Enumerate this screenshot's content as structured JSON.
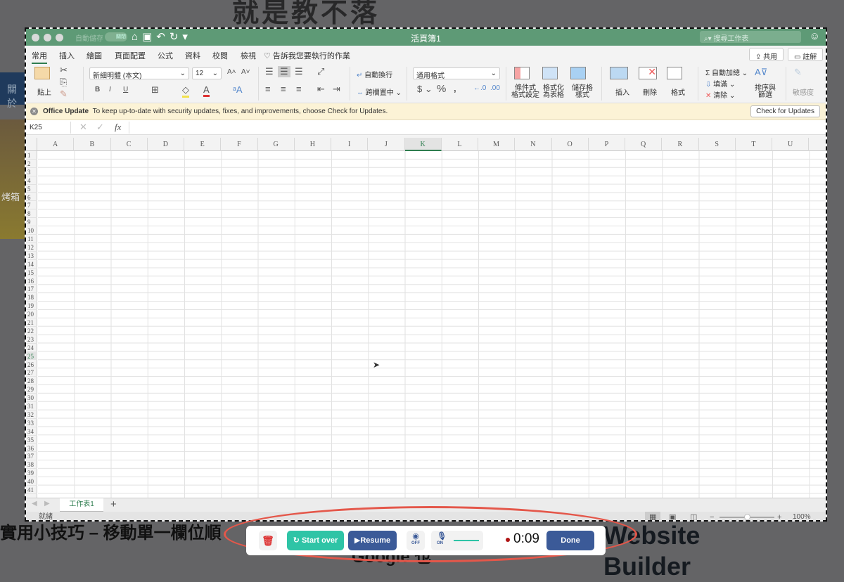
{
  "background": {
    "logo_text": "就是教不落",
    "nav_label": "關於",
    "photo_caption": "烤箱",
    "article_title": "實用小技巧 – 移動單一欄位順",
    "article_subtitle": "Google 也",
    "side_title_1": "Website",
    "side_title_2": "Builder"
  },
  "titlebar": {
    "autosave": "自動儲存",
    "toggle": "關閉",
    "title": "活頁簿1",
    "search_placeholder": "搜尋工作表"
  },
  "tabs": [
    {
      "label": "常用",
      "active": true
    },
    {
      "label": "插入"
    },
    {
      "label": "繪圖"
    },
    {
      "label": "頁面配置"
    },
    {
      "label": "公式"
    },
    {
      "label": "資料"
    },
    {
      "label": "校閱"
    },
    {
      "label": "檢視"
    }
  ],
  "tell_me": "告訴我您要執行的作業",
  "share": "共用",
  "comments": "註解",
  "ribbon": {
    "paste": "貼上",
    "font": "新細明體 (本文)",
    "size": "12",
    "wrap": "自動換行",
    "merge": "跨欄置中",
    "number_format": "通用格式",
    "cond_format": [
      "條件式",
      "格式設定"
    ],
    "format_table": [
      "格式化",
      "為表格"
    ],
    "cell_styles": [
      "儲存格",
      "樣式"
    ],
    "insert": "插入",
    "delete": "刪除",
    "format": "格式",
    "autosum": "自動加總",
    "fill": "填滿",
    "clear": "清除",
    "sort": [
      "排序與",
      "篩選"
    ],
    "sensitivity": "敏感度"
  },
  "update": {
    "title": "Office Update",
    "message": "To keep up-to-date with security updates, fixes, and improvements, choose Check for Updates.",
    "button": "Check for Updates"
  },
  "formula": {
    "name_box": "K25",
    "fx": "fx",
    "value": ""
  },
  "sheet": {
    "columns": [
      "A",
      "B",
      "C",
      "D",
      "E",
      "F",
      "G",
      "H",
      "I",
      "J",
      "K",
      "L",
      "M",
      "N",
      "O",
      "P",
      "Q",
      "R",
      "S",
      "T",
      "U"
    ],
    "selected_column": "K",
    "rows": 41,
    "selected_row": 25
  },
  "sheet_tabs": {
    "active": "工作表1",
    "add": "+"
  },
  "status": {
    "text": "就緒",
    "zoom": "100%",
    "zoom_level": 100
  },
  "recorder": {
    "start_over": "Start over",
    "resume": "Resume",
    "camera": "OFF",
    "mic": "ON",
    "time": "0:09",
    "done": "Done",
    "accent": "#2ec4a6",
    "primary": "#3b5a98"
  }
}
